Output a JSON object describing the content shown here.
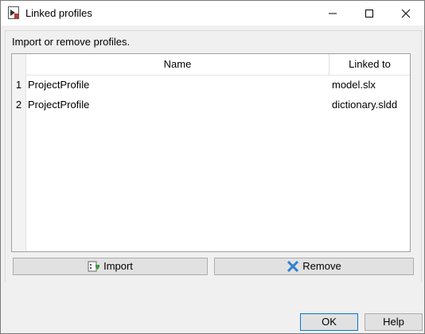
{
  "window": {
    "title": "Linked profiles"
  },
  "instructions": "Import or remove profiles.",
  "table": {
    "columns": [
      "Name",
      "Linked to"
    ],
    "rows": [
      {
        "num": "1",
        "name": "ProjectProfile",
        "linked": "model.slx"
      },
      {
        "num": "2",
        "name": "ProjectProfile",
        "linked": "dictionary.sldd"
      }
    ]
  },
  "buttons": {
    "import": "Import",
    "remove": "Remove",
    "ok": "OK",
    "help": "Help"
  }
}
